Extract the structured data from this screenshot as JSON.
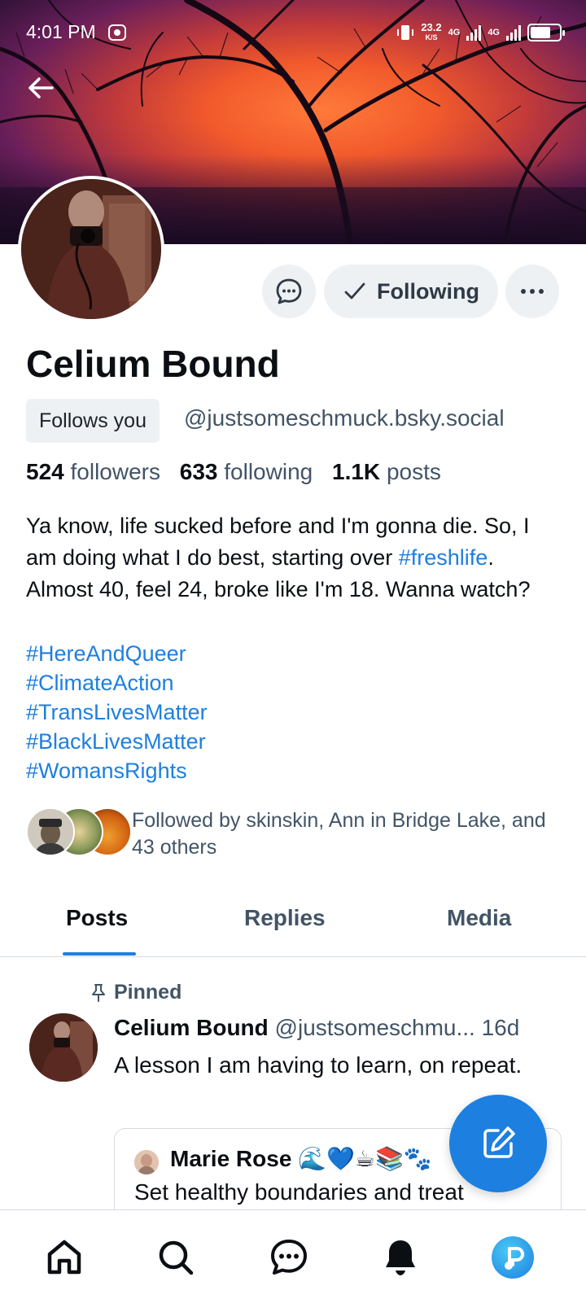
{
  "status_bar": {
    "time": "4:01 PM",
    "speed_value": "23.2",
    "speed_unit": "K/S",
    "network_1": "4G",
    "network_2": "4G"
  },
  "profile": {
    "display_name": "Celium Bound",
    "follows_you_label": "Follows you",
    "handle": "@justsomeschmuck.bsky.social",
    "following_button_label": "Following",
    "stats": {
      "followers_count": "524",
      "followers_label": "followers",
      "following_count": "633",
      "following_label": "following",
      "posts_count": "1.1K",
      "posts_label": "posts"
    },
    "bio": {
      "text_1": "Ya know, life sucked before and I'm gonna die. So, I am doing what I do best, starting over ",
      "hashtag_inline": "#freshlife",
      "text_2": ". Almost 40, feel 24, broke like I'm 18.  Wanna watch?",
      "hashtags": [
        "#HereAndQueer",
        "#ClimateAction",
        "#TransLivesMatter",
        "#BlackLivesMatter",
        "#WomansRights"
      ]
    },
    "known_followers_text": "Followed by skinskin, Ann in Bridge Lake, and 43 others"
  },
  "tabs": [
    {
      "label": "Posts",
      "active": true
    },
    {
      "label": "Replies",
      "active": false
    },
    {
      "label": "Media",
      "active": false
    }
  ],
  "pinned_post": {
    "pinned_label": "Pinned",
    "author_name": "Celium Bound",
    "author_handle": "@justsomeschmu...",
    "time_ago": "16d",
    "text": "A lesson I am having to learn, on repeat.",
    "quote": {
      "author_name": "Marie Rose 🌊💙☕📚🐾",
      "text": "Set healthy boundaries and treat"
    }
  },
  "bottom_nav": {
    "items": [
      "home-icon",
      "search-icon",
      "chat-icon",
      "bell-icon",
      "profile-avatar"
    ]
  },
  "colors": {
    "accent": "#1d7fe0",
    "muted_text": "#425466",
    "button_bg": "#eef1f4"
  }
}
